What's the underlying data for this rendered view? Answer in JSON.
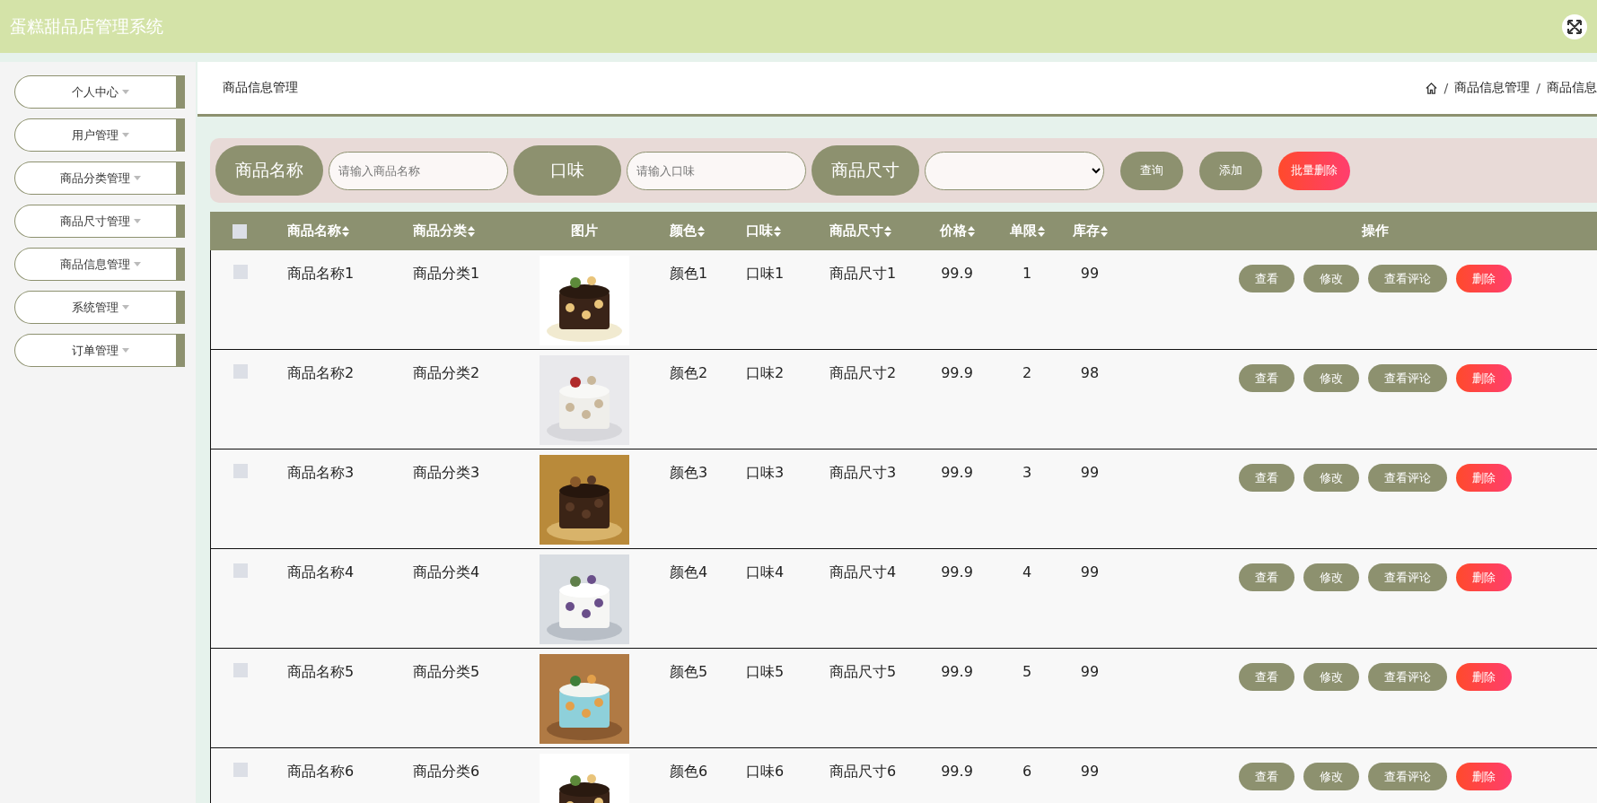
{
  "header": {
    "title": "蛋糕甜品店管理系统"
  },
  "sidebar": {
    "items": [
      {
        "label": "个人中心"
      },
      {
        "label": "用户管理"
      },
      {
        "label": "商品分类管理"
      },
      {
        "label": "商品尺寸管理"
      },
      {
        "label": "商品信息管理"
      },
      {
        "label": "系统管理"
      },
      {
        "label": "订单管理"
      }
    ]
  },
  "page_title": "商品信息管理",
  "breadcrumb": [
    {
      "kind": "separator",
      "text": "/"
    },
    {
      "kind": "link",
      "text": "商品信息管理"
    },
    {
      "kind": "separator",
      "text": "/"
    },
    {
      "kind": "link",
      "text": "商品信息"
    }
  ],
  "search": {
    "fields": [
      {
        "label": "商品名称",
        "kind": "input",
        "placeholder": "请输入商品名称"
      },
      {
        "label": "口味",
        "kind": "input",
        "placeholder": "请输入口味"
      },
      {
        "label": "商品尺寸",
        "kind": "select"
      }
    ],
    "buttons": [
      {
        "label": "查询",
        "kind": "primary"
      },
      {
        "label": "添加",
        "kind": "primary"
      },
      {
        "label": "批量删除",
        "kind": "danger"
      }
    ]
  },
  "table": {
    "header_checked": false,
    "columns": [
      {
        "label": "商品名称",
        "sortable": true
      },
      {
        "label": "商品分类",
        "sortable": true
      },
      {
        "label": "图片",
        "sortable": false
      },
      {
        "label": "颜色",
        "sortable": true
      },
      {
        "label": "口味",
        "sortable": true
      },
      {
        "label": "商品尺寸",
        "sortable": true
      },
      {
        "label": "价格",
        "sortable": true
      },
      {
        "label": "单限",
        "sortable": true
      },
      {
        "label": "库存",
        "sortable": true
      },
      {
        "label": "操作",
        "sortable": false
      }
    ],
    "rows": [
      {
        "checked": false,
        "cells": [
          {
            "kind": "text",
            "text": "商品名称1"
          },
          {
            "kind": "text",
            "text": "商品分类1"
          },
          {
            "kind": "picture"
          },
          {
            "kind": "text",
            "text": "颜色1"
          },
          {
            "kind": "text",
            "text": "口味1"
          },
          {
            "kind": "text",
            "text": "商品尺寸1"
          },
          {
            "kind": "text",
            "text": "99.9"
          },
          {
            "kind": "text",
            "text": "1"
          },
          {
            "kind": "text",
            "text": "99"
          }
        ],
        "actions": [
          {
            "label": "查看",
            "kind": "primary"
          },
          {
            "label": "修改",
            "kind": "primary"
          },
          {
            "label": "查看评论",
            "kind": "primary"
          },
          {
            "label": "删除",
            "kind": "danger"
          }
        ]
      },
      {
        "checked": false,
        "cells": [
          {
            "kind": "text",
            "text": "商品名称2"
          },
          {
            "kind": "text",
            "text": "商品分类2"
          },
          {
            "kind": "picture"
          },
          {
            "kind": "text",
            "text": "颜色2"
          },
          {
            "kind": "text",
            "text": "口味2"
          },
          {
            "kind": "text",
            "text": "商品尺寸2"
          },
          {
            "kind": "text",
            "text": "99.9"
          },
          {
            "kind": "text",
            "text": "2"
          },
          {
            "kind": "text",
            "text": "98"
          }
        ],
        "actions": [
          {
            "label": "查看",
            "kind": "primary"
          },
          {
            "label": "修改",
            "kind": "primary"
          },
          {
            "label": "查看评论",
            "kind": "primary"
          },
          {
            "label": "删除",
            "kind": "danger"
          }
        ]
      },
      {
        "checked": false,
        "cells": [
          {
            "kind": "text",
            "text": "商品名称3"
          },
          {
            "kind": "text",
            "text": "商品分类3"
          },
          {
            "kind": "picture"
          },
          {
            "kind": "text",
            "text": "颜色3"
          },
          {
            "kind": "text",
            "text": "口味3"
          },
          {
            "kind": "text",
            "text": "商品尺寸3"
          },
          {
            "kind": "text",
            "text": "99.9"
          },
          {
            "kind": "text",
            "text": "3"
          },
          {
            "kind": "text",
            "text": "99"
          }
        ],
        "actions": [
          {
            "label": "查看",
            "kind": "primary"
          },
          {
            "label": "修改",
            "kind": "primary"
          },
          {
            "label": "查看评论",
            "kind": "primary"
          },
          {
            "label": "删除",
            "kind": "danger"
          }
        ]
      },
      {
        "checked": false,
        "cells": [
          {
            "kind": "text",
            "text": "商品名称4"
          },
          {
            "kind": "text",
            "text": "商品分类4"
          },
          {
            "kind": "picture"
          },
          {
            "kind": "text",
            "text": "颜色4"
          },
          {
            "kind": "text",
            "text": "口味4"
          },
          {
            "kind": "text",
            "text": "商品尺寸4"
          },
          {
            "kind": "text",
            "text": "99.9"
          },
          {
            "kind": "text",
            "text": "4"
          },
          {
            "kind": "text",
            "text": "99"
          }
        ],
        "actions": [
          {
            "label": "查看",
            "kind": "primary"
          },
          {
            "label": "修改",
            "kind": "primary"
          },
          {
            "label": "查看评论",
            "kind": "primary"
          },
          {
            "label": "删除",
            "kind": "danger"
          }
        ]
      },
      {
        "checked": false,
        "cells": [
          {
            "kind": "text",
            "text": "商品名称5"
          },
          {
            "kind": "text",
            "text": "商品分类5"
          },
          {
            "kind": "picture"
          },
          {
            "kind": "text",
            "text": "颜色5"
          },
          {
            "kind": "text",
            "text": "口味5"
          },
          {
            "kind": "text",
            "text": "商品尺寸5"
          },
          {
            "kind": "text",
            "text": "99.9"
          },
          {
            "kind": "text",
            "text": "5"
          },
          {
            "kind": "text",
            "text": "99"
          }
        ],
        "actions": [
          {
            "label": "查看",
            "kind": "primary"
          },
          {
            "label": "修改",
            "kind": "primary"
          },
          {
            "label": "查看评论",
            "kind": "primary"
          },
          {
            "label": "删除",
            "kind": "danger"
          }
        ]
      },
      {
        "checked": false,
        "cells": [
          {
            "kind": "text",
            "text": "商品名称6"
          },
          {
            "kind": "text",
            "text": "商品分类6"
          },
          {
            "kind": "picture"
          },
          {
            "kind": "text",
            "text": "颜色6"
          },
          {
            "kind": "text",
            "text": "口味6"
          },
          {
            "kind": "text",
            "text": "商品尺寸6"
          },
          {
            "kind": "text",
            "text": "99.9"
          },
          {
            "kind": "text",
            "text": "6"
          },
          {
            "kind": "text",
            "text": "99"
          }
        ],
        "actions": [
          {
            "label": "查看",
            "kind": "primary"
          },
          {
            "label": "修改",
            "kind": "primary"
          },
          {
            "label": "查看评论",
            "kind": "primary"
          },
          {
            "label": "删除",
            "kind": "danger"
          }
        ]
      }
    ]
  }
}
